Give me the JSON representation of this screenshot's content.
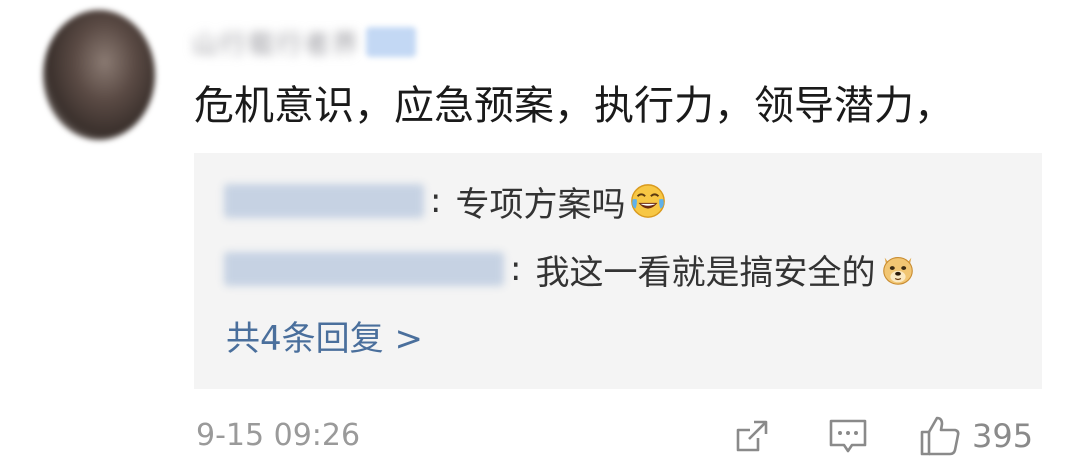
{
  "comment": {
    "username": "山行载行者界",
    "text": "危机意识，应急预案，执行力，领导潜力，"
  },
  "replies": [
    {
      "author": "山·张跃业者",
      "separator": ":",
      "text": "专项方案吗",
      "emoji": "tears-of-joy-emoji"
    },
    {
      "author": "陈行行的秘事品",
      "separator": ":",
      "text": "我这一看就是搞安全的",
      "emoji": "doge-emoji"
    }
  ],
  "more_replies": "共4条回复 >",
  "timestamp": "9-15 09:26",
  "actions": {
    "share_icon": "share-icon",
    "comment_icon": "comment-icon",
    "like_icon": "thumbs-up-icon",
    "like_count": "395"
  },
  "colors": {
    "link": "#4a6f9c",
    "reply_bg": "#f4f4f4",
    "muted": "#9a9a9a"
  }
}
